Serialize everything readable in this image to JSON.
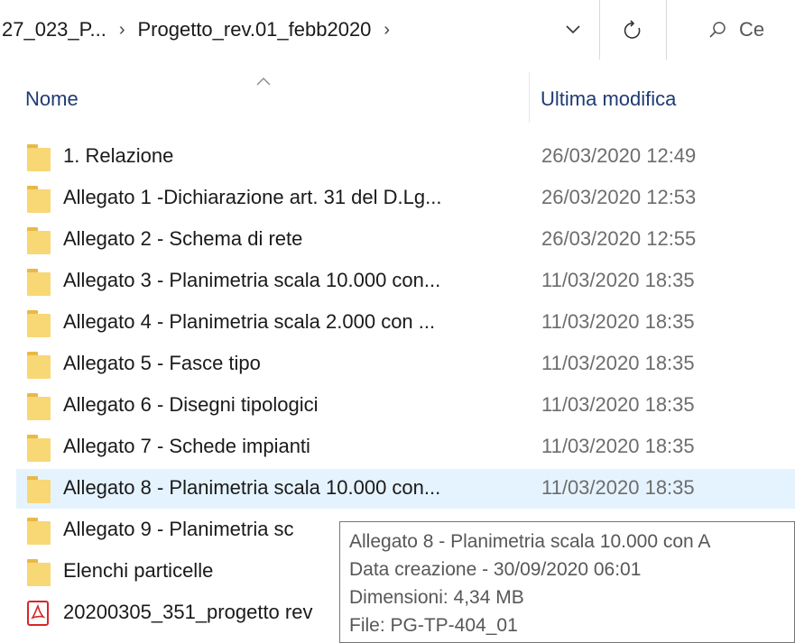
{
  "address": {
    "crumbs": [
      "27_023_P...",
      "Progetto_rev.01_febb2020"
    ],
    "search_placeholder": "Ce"
  },
  "columns": {
    "name": "Nome",
    "modified": "Ultima modifica"
  },
  "files": [
    {
      "name": "1. Relazione",
      "modified": "26/03/2020 12:49",
      "icon": "folder-icon"
    },
    {
      "name": "Allegato 1 -Dichiarazione art. 31 del D.Lg...",
      "modified": "26/03/2020 12:53",
      "icon": "folder-icon"
    },
    {
      "name": "Allegato 2 - Schema di rete",
      "modified": "26/03/2020 12:55",
      "icon": "folder-icon"
    },
    {
      "name": "Allegato 3 - Planimetria scala 10.000  con...",
      "modified": "11/03/2020 18:35",
      "icon": "folder-icon"
    },
    {
      "name": "Allegato 4 - Planimetria scala 2.000  con ...",
      "modified": "11/03/2020 18:35",
      "icon": "folder-icon"
    },
    {
      "name": "Allegato 5 - Fasce tipo",
      "modified": "11/03/2020 18:35",
      "icon": "folder-icon"
    },
    {
      "name": "Allegato 6 - Disegni tipologici",
      "modified": "11/03/2020 18:35",
      "icon": "folder-icon"
    },
    {
      "name": "Allegato 7 - Schede impianti",
      "modified": "11/03/2020 18:35",
      "icon": "folder-icon"
    },
    {
      "name": "Allegato 8 - Planimetria scala 10.000  con...",
      "modified": "11/03/2020 18:35",
      "icon": "folder-icon",
      "selected": true
    },
    {
      "name": "Allegato 9 - Planimetria sc",
      "modified": "",
      "icon": "folder-icon"
    },
    {
      "name": "Elenchi particelle",
      "modified": "",
      "icon": "folder-icon"
    },
    {
      "name": "20200305_351_progetto rev",
      "modified": "",
      "icon": "pdf-icon"
    }
  ],
  "tooltip": {
    "line1": "Allegato 8 - Planimetria scala 10.000  con A",
    "line2": "Data creazione - 30/09/2020 06:01",
    "line3": "Dimensioni: 4,34 MB",
    "line4": "File: PG-TP-404_01"
  },
  "colors": {
    "selection": "#e5f3ff",
    "folder": "#f8d775",
    "header_text": "#1f3b73",
    "pdf": "#d9252a"
  }
}
